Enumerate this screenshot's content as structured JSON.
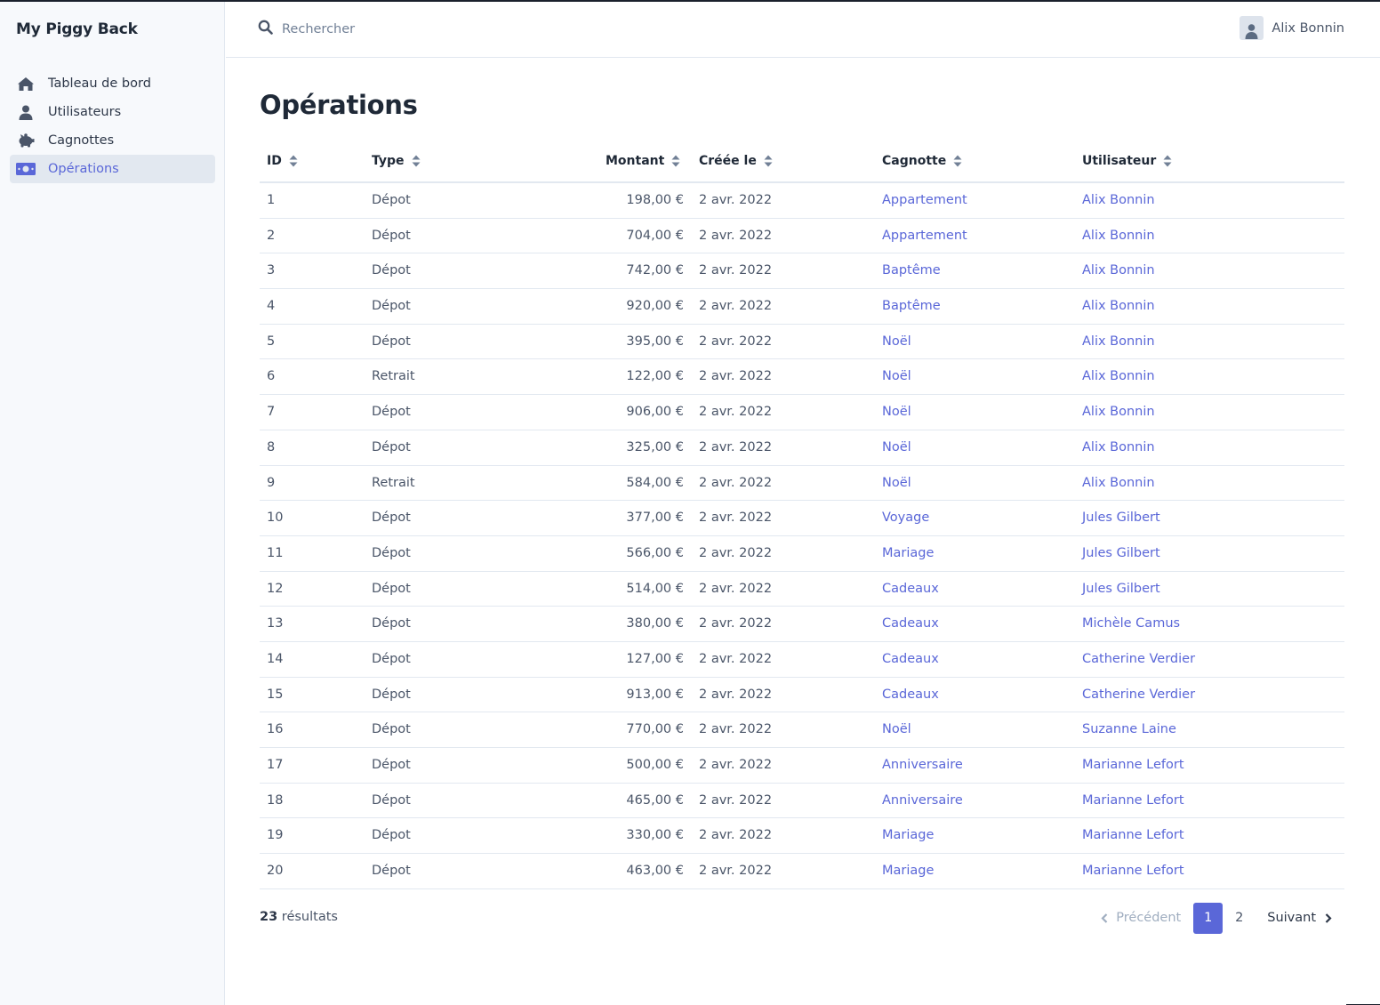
{
  "app": {
    "brand": "My Piggy Back"
  },
  "sidebar": {
    "items": [
      {
        "label": "Tableau de bord",
        "icon": "home-icon",
        "active": false
      },
      {
        "label": "Utilisateurs",
        "icon": "user-icon",
        "active": false
      },
      {
        "label": "Cagnottes",
        "icon": "piggy-bank-icon",
        "active": false
      },
      {
        "label": "Opérations",
        "icon": "money-bill-icon",
        "active": true
      }
    ]
  },
  "header": {
    "search": {
      "placeholder": "Rechercher",
      "value": "",
      "icon": "search-icon"
    },
    "user": {
      "name": "Alix Bonnin",
      "icon": "user-icon"
    }
  },
  "page": {
    "title": "Opérations"
  },
  "table": {
    "columns": {
      "id": "ID",
      "type": "Type",
      "amount": "Montant",
      "created": "Créée le",
      "pot": "Cagnotte",
      "user": "Utilisateur"
    },
    "rows": [
      {
        "id": "1",
        "type": "Dépot",
        "amount": "198,00 €",
        "created": "2 avr. 2022",
        "pot": "Appartement",
        "user": "Alix Bonnin"
      },
      {
        "id": "2",
        "type": "Dépot",
        "amount": "704,00 €",
        "created": "2 avr. 2022",
        "pot": "Appartement",
        "user": "Alix Bonnin"
      },
      {
        "id": "3",
        "type": "Dépot",
        "amount": "742,00 €",
        "created": "2 avr. 2022",
        "pot": "Baptême",
        "user": "Alix Bonnin"
      },
      {
        "id": "4",
        "type": "Dépot",
        "amount": "920,00 €",
        "created": "2 avr. 2022",
        "pot": "Baptême",
        "user": "Alix Bonnin"
      },
      {
        "id": "5",
        "type": "Dépot",
        "amount": "395,00 €",
        "created": "2 avr. 2022",
        "pot": "Noël",
        "user": "Alix Bonnin"
      },
      {
        "id": "6",
        "type": "Retrait",
        "amount": "122,00 €",
        "created": "2 avr. 2022",
        "pot": "Noël",
        "user": "Alix Bonnin"
      },
      {
        "id": "7",
        "type": "Dépot",
        "amount": "906,00 €",
        "created": "2 avr. 2022",
        "pot": "Noël",
        "user": "Alix Bonnin"
      },
      {
        "id": "8",
        "type": "Dépot",
        "amount": "325,00 €",
        "created": "2 avr. 2022",
        "pot": "Noël",
        "user": "Alix Bonnin"
      },
      {
        "id": "9",
        "type": "Retrait",
        "amount": "584,00 €",
        "created": "2 avr. 2022",
        "pot": "Noël",
        "user": "Alix Bonnin"
      },
      {
        "id": "10",
        "type": "Dépot",
        "amount": "377,00 €",
        "created": "2 avr. 2022",
        "pot": "Voyage",
        "user": "Jules Gilbert"
      },
      {
        "id": "11",
        "type": "Dépot",
        "amount": "566,00 €",
        "created": "2 avr. 2022",
        "pot": "Mariage",
        "user": "Jules Gilbert"
      },
      {
        "id": "12",
        "type": "Dépot",
        "amount": "514,00 €",
        "created": "2 avr. 2022",
        "pot": "Cadeaux",
        "user": "Jules Gilbert"
      },
      {
        "id": "13",
        "type": "Dépot",
        "amount": "380,00 €",
        "created": "2 avr. 2022",
        "pot": "Cadeaux",
        "user": "Michèle Camus"
      },
      {
        "id": "14",
        "type": "Dépot",
        "amount": "127,00 €",
        "created": "2 avr. 2022",
        "pot": "Cadeaux",
        "user": "Catherine Verdier"
      },
      {
        "id": "15",
        "type": "Dépot",
        "amount": "913,00 €",
        "created": "2 avr. 2022",
        "pot": "Cadeaux",
        "user": "Catherine Verdier"
      },
      {
        "id": "16",
        "type": "Dépot",
        "amount": "770,00 €",
        "created": "2 avr. 2022",
        "pot": "Noël",
        "user": "Suzanne Laine"
      },
      {
        "id": "17",
        "type": "Dépot",
        "amount": "500,00 €",
        "created": "2 avr. 2022",
        "pot": "Anniversaire",
        "user": "Marianne Lefort"
      },
      {
        "id": "18",
        "type": "Dépot",
        "amount": "465,00 €",
        "created": "2 avr. 2022",
        "pot": "Anniversaire",
        "user": "Marianne Lefort"
      },
      {
        "id": "19",
        "type": "Dépot",
        "amount": "330,00 €",
        "created": "2 avr. 2022",
        "pot": "Mariage",
        "user": "Marianne Lefort"
      },
      {
        "id": "20",
        "type": "Dépot",
        "amount": "463,00 €",
        "created": "2 avr. 2022",
        "pot": "Mariage",
        "user": "Marianne Lefort"
      }
    ]
  },
  "footer": {
    "results_count": "23",
    "results_label": "résultats",
    "pagination": {
      "previous": "Précédent",
      "next": "Suivant",
      "pages": [
        "1",
        "2"
      ],
      "current": "1"
    }
  },
  "colors": {
    "accent": "#5a67d8",
    "sidebar_bg": "#f7f9fc",
    "active_bg": "#e2e8f0",
    "text": "#2d3748",
    "muted": "#a0aec0"
  }
}
